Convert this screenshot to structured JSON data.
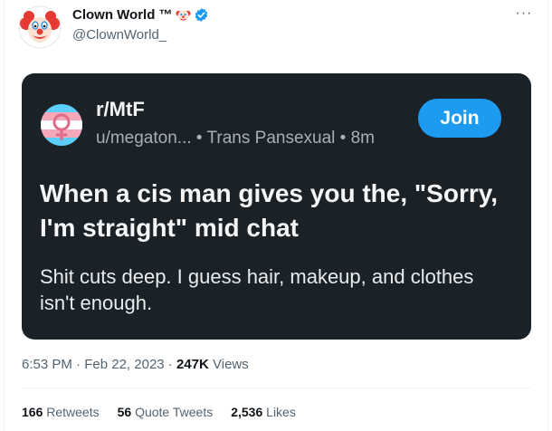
{
  "author": {
    "display_name": "Clown World ™",
    "handle": "@ClownWorld_",
    "icons": [
      "clown-avatar",
      "clown-emoji",
      "verified-badge"
    ]
  },
  "header": {
    "more_label": "···"
  },
  "embed": {
    "subreddit": "r/MtF",
    "user": "u/megaton...",
    "flair": "Trans Pansexual",
    "age": "8m",
    "separator": "•",
    "join_label": "Join",
    "title": "When a cis man gives you the, \"Sorry, I'm straight\" mid chat",
    "body": "Shit cuts deep. I guess hair, makeup, and clothes isn't enough.",
    "colors": {
      "card_bg": "#1a2228",
      "join": "#1d9bf0",
      "flag_blue": "#5bcefa",
      "flag_pink": "#f5a9b8"
    }
  },
  "meta": {
    "time": "6:53 PM",
    "dot": "·",
    "date": "Feb 22, 2023",
    "views_count": "247K",
    "views_label": "Views"
  },
  "stats": {
    "retweets_count": "166",
    "retweets_label": "Retweets",
    "quotes_count": "56",
    "quotes_label": "Quote Tweets",
    "likes_count": "2,536",
    "likes_label": "Likes"
  }
}
